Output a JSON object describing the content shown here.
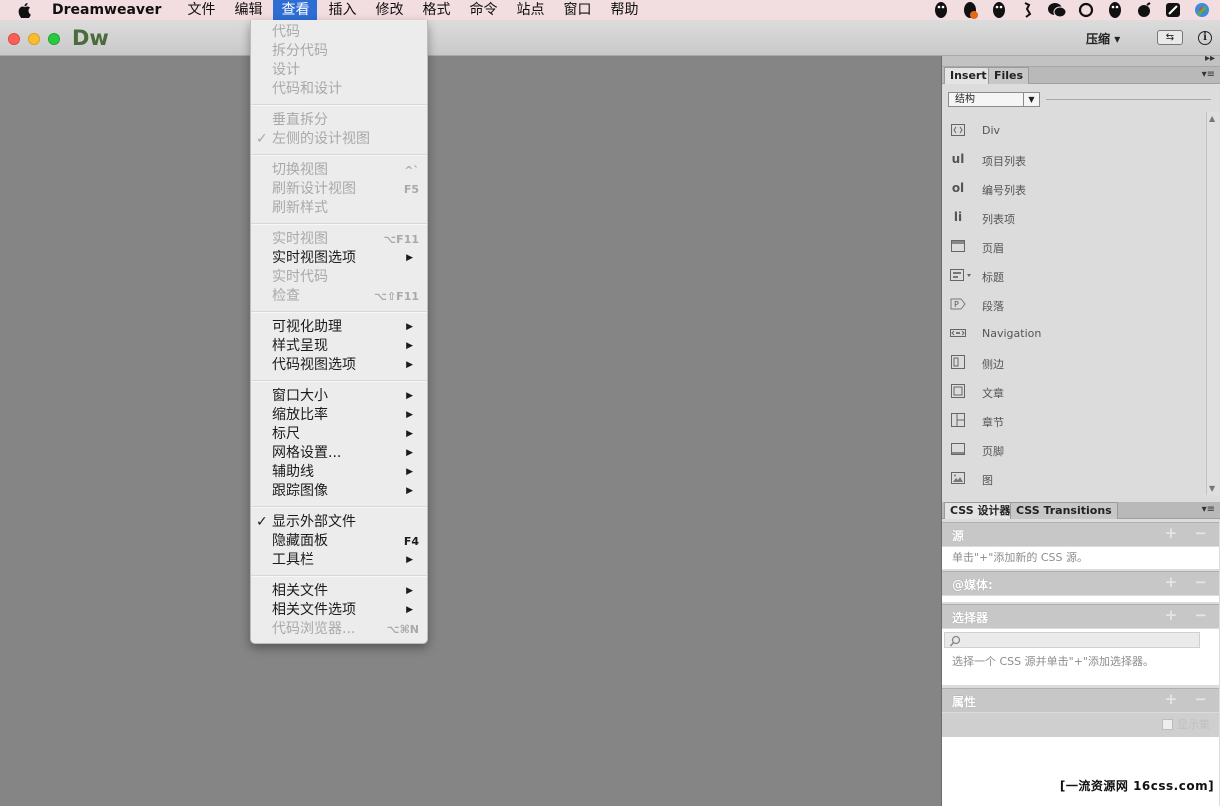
{
  "menubar": {
    "app_name": "Dreamweaver",
    "items": [
      "文件",
      "编辑",
      "查看",
      "插入",
      "修改",
      "格式",
      "命令",
      "站点",
      "窗口",
      "帮助"
    ],
    "active_index": 2,
    "tray_icons": [
      "qq-penguin-icon",
      "qq-penguin-icon",
      "qq-penguin-icon",
      "phone-icon",
      "wechat-icon",
      "circle-icon",
      "qq-penguin-icon",
      "bomb-icon",
      "edit-icon",
      "browser-icon"
    ]
  },
  "appbar": {
    "logo": "Dw",
    "workspace_label": "压缩",
    "dropdown_arrow": "▾",
    "sync_label": "⇆",
    "info_label": "i"
  },
  "view_menu": {
    "items": [
      {
        "label": "代码",
        "enabled": false
      },
      {
        "label": "拆分代码",
        "enabled": false
      },
      {
        "label": "设计",
        "enabled": false
      },
      {
        "label": "代码和设计",
        "enabled": false
      },
      {
        "label": "垂直拆分",
        "enabled": false
      },
      {
        "label": "左侧的设计视图",
        "enabled": false,
        "checked": true
      },
      {
        "label": "切换视图",
        "enabled": false,
        "shortcut": "^`"
      },
      {
        "label": "刷新设计视图",
        "enabled": false,
        "shortcut": "F5"
      },
      {
        "label": "刷新样式",
        "enabled": false
      },
      {
        "label": "实时视图",
        "enabled": false,
        "shortcut": "⌥F11"
      },
      {
        "label": "实时视图选项",
        "enabled": true,
        "submenu": true
      },
      {
        "label": "实时代码",
        "enabled": false
      },
      {
        "label": "检查",
        "enabled": false,
        "shortcut": "⌥⇧F11"
      },
      {
        "label": "可视化助理",
        "enabled": true,
        "submenu": true
      },
      {
        "label": "样式呈现",
        "enabled": true,
        "submenu": true
      },
      {
        "label": "代码视图选项",
        "enabled": true,
        "submenu": true
      },
      {
        "label": "窗口大小",
        "enabled": true,
        "submenu": true
      },
      {
        "label": "缩放比率",
        "enabled": true,
        "submenu": true
      },
      {
        "label": "标尺",
        "enabled": true,
        "submenu": true
      },
      {
        "label": "网格设置...",
        "enabled": true,
        "submenu": true
      },
      {
        "label": "辅助线",
        "enabled": true,
        "submenu": true
      },
      {
        "label": "跟踪图像",
        "enabled": true,
        "submenu": true
      },
      {
        "label": "显示外部文件",
        "enabled": true,
        "checked": true
      },
      {
        "label": "隐藏面板",
        "enabled": true,
        "shortcut": "F4"
      },
      {
        "label": "工具栏",
        "enabled": true,
        "submenu": true
      },
      {
        "label": "相关文件",
        "enabled": true,
        "submenu": true
      },
      {
        "label": "相关文件选项",
        "enabled": true,
        "submenu": true
      },
      {
        "label": "代码浏览器...",
        "enabled": false,
        "shortcut": "⌥⌘N"
      }
    ],
    "check_glyph": "✓",
    "submenu_glyph": "▶"
  },
  "panel_top": {
    "collapse_glyph": "▸▸"
  },
  "insert_panel": {
    "tabs": [
      "Insert",
      "Files"
    ],
    "menu_glyph": "▾≡",
    "category": "结构",
    "items": [
      {
        "label": "Div",
        "icon": "div-icon"
      },
      {
        "label": "项目列表",
        "icon": "ul-icon"
      },
      {
        "label": "编号列表",
        "icon": "ol-icon"
      },
      {
        "label": "列表项",
        "icon": "li-icon"
      },
      {
        "label": "页眉",
        "icon": "header-icon"
      },
      {
        "label": "标题",
        "icon": "heading-icon"
      },
      {
        "label": "段落",
        "icon": "paragraph-icon"
      },
      {
        "label": "Navigation",
        "icon": "navigation-icon"
      },
      {
        "label": "侧边",
        "icon": "aside-icon"
      },
      {
        "label": "文章",
        "icon": "article-icon"
      },
      {
        "label": "章节",
        "icon": "section-icon"
      },
      {
        "label": "页脚",
        "icon": "footer-icon"
      },
      {
        "label": "图",
        "icon": "figure-icon"
      }
    ],
    "icon_text": {
      "ul": "ul",
      "ol": "ol",
      "li": "li"
    }
  },
  "css_panel": {
    "tabs": [
      "CSS 设计器",
      "CSS Transitions"
    ],
    "plus_minus": "+ −",
    "sources_title": "源",
    "sources_hint": "单击\"+\"添加新的 CSS 源。",
    "media_title": "@媒体:",
    "selectors_title": "选择器",
    "selectors_hint": "选择一个 CSS 源并单击\"+\"添加选择器。",
    "properties_title": "属性",
    "show_set_label": "显示集"
  },
  "watermark": "[一流资源网 16css.com]"
}
